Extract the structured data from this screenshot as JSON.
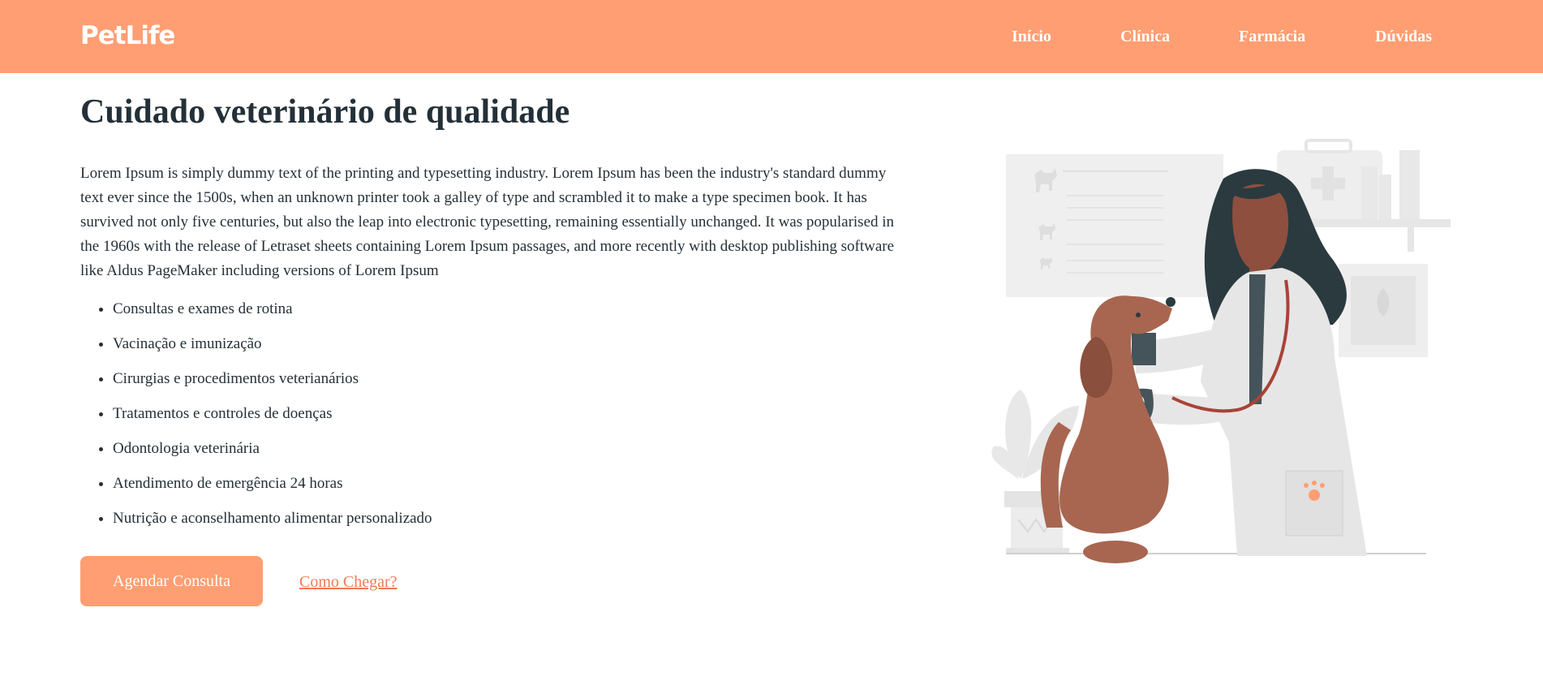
{
  "header": {
    "logo": "PetLife",
    "nav": [
      "Início",
      "Clínica",
      "Farmácia",
      "Dúvidas"
    ]
  },
  "main": {
    "title": "Cuidado veterinário de qualidade",
    "description": "Lorem Ipsum is simply dummy text of the printing and typesetting industry. Lorem Ipsum has been the industry's standard dummy text ever since the 1500s, when an unknown printer took a galley of type and scrambled it to make a type specimen book. It has survived not only five centuries, but also the leap into electronic typesetting, remaining essentially unchanged. It was popularised in the 1960s with the release of Letraset sheets containing Lorem Ipsum passages, and more recently with desktop publishing software like Aldus PageMaker including versions of Lorem Ipsum",
    "services": [
      "Consultas e exames de rotina",
      "Vacinação e imunização",
      "Cirurgias e procedimentos veterianários",
      "Tratamentos e controles de doenças",
      "Odontologia veterinária",
      "Atendimento de emergência 24 horas",
      "Nutrição e aconselhamento alimentar personalizado"
    ],
    "cta_label": "Agendar Consulta",
    "directions_label": "Como Chegar?"
  },
  "colors": {
    "brand": "#ff9e72",
    "text": "#243038",
    "link": "#f07a55"
  },
  "illustration": "veterinarian-with-dog-illustration"
}
